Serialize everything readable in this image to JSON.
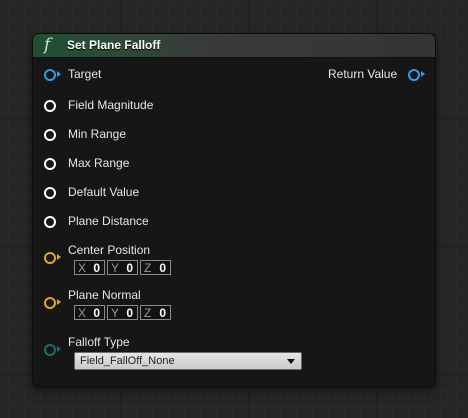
{
  "node": {
    "title": "Set Plane Falloff",
    "func_glyph": "f",
    "inputs": {
      "target": "Target",
      "field_magnitude": "Field Magnitude",
      "min_range": "Min Range",
      "max_range": "Max Range",
      "default_value": "Default Value",
      "plane_distance": "Plane Distance",
      "center_position": "Center Position",
      "plane_normal": "Plane Normal",
      "falloff_type": "Falloff Type"
    },
    "outputs": {
      "return_value": "Return Value"
    },
    "center_position": {
      "x_label": "X",
      "x": "0",
      "y_label": "Y",
      "y": "0",
      "z_label": "Z",
      "z": "0"
    },
    "plane_normal": {
      "x_label": "X",
      "x": "0",
      "y_label": "Y",
      "y": "0",
      "z_label": "Z",
      "z": "0"
    },
    "falloff_type_value": "Field_FallOff_None"
  },
  "colors": {
    "object_pin": "#2aa0e6",
    "float_pin": "#ffffff",
    "vector_pin": "#e2a71d",
    "enum_pin": "#1b6e6e",
    "header_accent": "#1f4f33"
  },
  "icons": {
    "function": "function-icon",
    "dropdown": "chevron-down-icon"
  }
}
